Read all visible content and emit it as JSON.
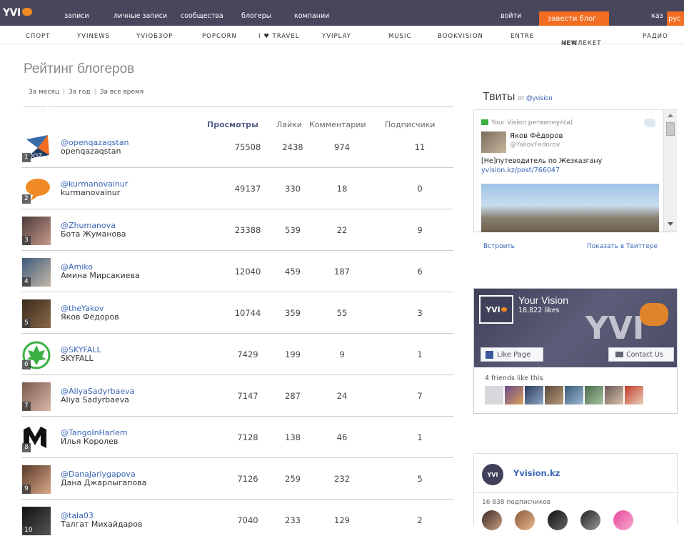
{
  "topbar": {
    "logo_text": "YVI",
    "nav": [
      "записи",
      "личные записи",
      "сообщества",
      "блогеры",
      "компании"
    ],
    "login": "войти",
    "start_blog": "завести блог",
    "lang_kaz": "каз",
    "lang_rus": "рус"
  },
  "secnav": {
    "items": [
      "СПОРТ",
      "YVINEWS",
      "YVIОБЗОР",
      "POPCORN",
      "I ♥ TRAVEL",
      "YVIPLAY",
      "MUSIC",
      "BOOKVISION",
      "ENTRE",
      "МЕМЛЕКЕТ",
      "РАДИО"
    ],
    "new_badge": "NEW"
  },
  "page": {
    "title": "Рейтинг блогеров",
    "tabs": [
      "За месяц",
      "За год",
      "За все время"
    ],
    "columns": [
      "Просмотры",
      "Лайки",
      "Комментарии",
      "Подписчики"
    ]
  },
  "bloggers": [
    {
      "rank": "1",
      "handle": "@openqazaqstan",
      "name": "openqazaqstan",
      "views": "75508",
      "likes": "2438",
      "comments": "974",
      "subs": "11"
    },
    {
      "rank": "2",
      "handle": "@kurmanovainur",
      "name": "kurmanovainur",
      "views": "49137",
      "likes": "330",
      "comments": "18",
      "subs": "0"
    },
    {
      "rank": "3",
      "handle": "@Zhumanova",
      "name": "Бота Жуманова",
      "views": "23388",
      "likes": "539",
      "comments": "22",
      "subs": "9"
    },
    {
      "rank": "4",
      "handle": "@Amiko",
      "name": "Амина Мирсакиева",
      "views": "12040",
      "likes": "459",
      "comments": "187",
      "subs": "6"
    },
    {
      "rank": "5",
      "handle": "@theYakov",
      "name": "Яков Фёдоров",
      "views": "10744",
      "likes": "359",
      "comments": "55",
      "subs": "3"
    },
    {
      "rank": "6",
      "handle": "@SKYFALL",
      "name": "SKYFALL",
      "views": "7429",
      "likes": "199",
      "comments": "9",
      "subs": "1"
    },
    {
      "rank": "7",
      "handle": "@AliyaSadyrbaeva",
      "name": "Aliya Sadyrbaeva",
      "views": "7147",
      "likes": "287",
      "comments": "24",
      "subs": "7"
    },
    {
      "rank": "8",
      "handle": "@TangoInHarlem",
      "name": "Илья Королев",
      "views": "7128",
      "likes": "138",
      "comments": "46",
      "subs": "1"
    },
    {
      "rank": "9",
      "handle": "@DanaJarlygapova",
      "name": "Дана Джарлыгапова",
      "views": "7126",
      "likes": "259",
      "comments": "232",
      "subs": "5"
    },
    {
      "rank": "10",
      "handle": "@tala03",
      "name": "Талгат Михайдаров",
      "views": "7040",
      "likes": "233",
      "comments": "129",
      "subs": "2"
    }
  ],
  "twitter": {
    "heading": "Твиты",
    "from": "от",
    "account": "@yvision",
    "retweet": "Your Vision ретвитнул(а)",
    "author_name": "Яков Фёдоров",
    "author_handle": "@YakovFedorov",
    "text": "[Не]путеводитель по Жезказгану",
    "link": "yvision.kz/post/766047",
    "embed": "Встроить",
    "show": "Показать в Твиттере"
  },
  "facebook": {
    "page_name": "Your Vision",
    "likes": "18,822 likes",
    "like_button": "Like Page",
    "contact_button": "Contact Us",
    "friends": "4 friends like this",
    "cover_logo": "YVI"
  },
  "yvision_widget": {
    "logo": "YVI",
    "name": "Yvision.kz",
    "subscribers": "16 838 подписчиков"
  },
  "colors": {
    "accent": "#f26c21",
    "topbar": "#48465b",
    "link": "#3a66b7"
  }
}
